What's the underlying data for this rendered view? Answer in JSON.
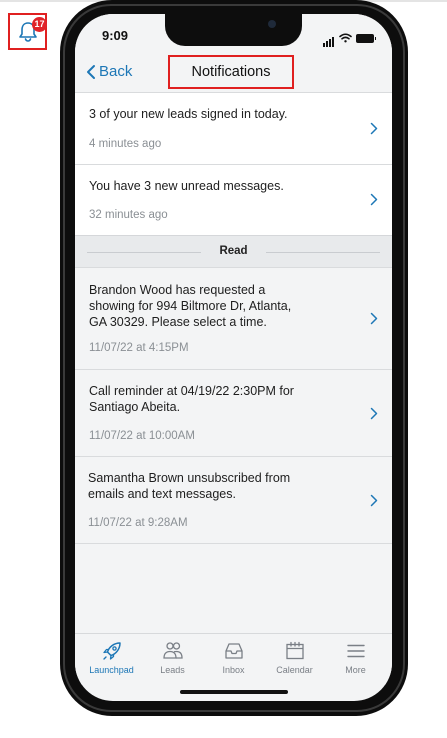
{
  "bell": {
    "badge_count": "17"
  },
  "status_bar": {
    "time": "9:09"
  },
  "nav": {
    "back_label": "Back",
    "title": "Notifications"
  },
  "unread": [
    {
      "message": "3 of your new leads signed in today.",
      "time": "4 minutes ago"
    },
    {
      "message": "You have 3 new unread messages.",
      "time": "32 minutes ago"
    }
  ],
  "read_section_label": "Read",
  "read": [
    {
      "message": "Brandon Wood has requested a showing for 994 Biltmore Dr, Atlanta, GA 30329. Please select a time.",
      "time": "11/07/22 at 4:15PM"
    },
    {
      "message": "Call reminder at 04/19/22 2:30PM for Santiago Abeita.",
      "time": "11/07/22 at 10:00AM"
    },
    {
      "message": "Samantha Brown unsubscribed from emails and text messages.",
      "time": "11/07/22 at 9:28AM"
    }
  ],
  "tabs": [
    {
      "label": "Launchpad",
      "icon": "rocket-icon",
      "active": true
    },
    {
      "label": "Leads",
      "icon": "people-icon",
      "active": false
    },
    {
      "label": "Inbox",
      "icon": "inbox-icon",
      "active": false
    },
    {
      "label": "Calendar",
      "icon": "calendar-icon",
      "active": false
    },
    {
      "label": "More",
      "icon": "menu-icon",
      "active": false
    }
  ],
  "colors": {
    "accent": "#1d77b6",
    "highlight_red": "#e02020",
    "badge_red": "#e0242a"
  }
}
